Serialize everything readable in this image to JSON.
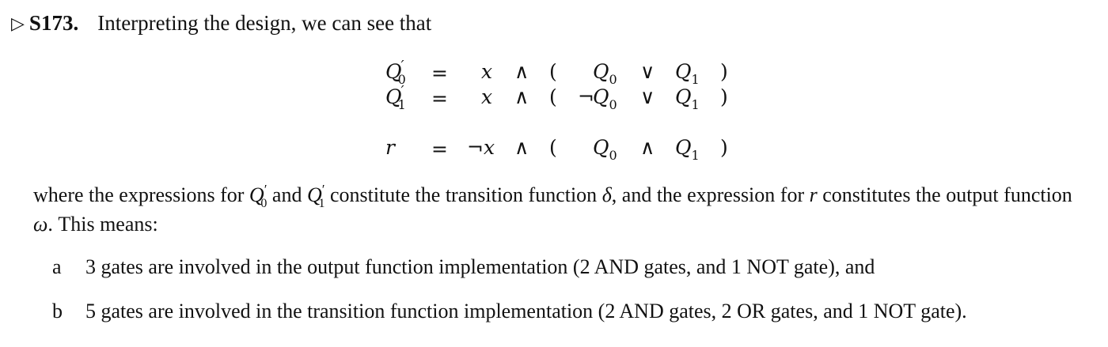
{
  "heading": {
    "marker": "▷",
    "number": "S173.",
    "text": "Interpreting the design, we can see that"
  },
  "equations": [
    {
      "lhs_base": "Q",
      "lhs_prime": "′",
      "lhs_sub": "0",
      "eq": "=",
      "x": "x",
      "op1": "∧",
      "open": "(",
      "neg": "",
      "a_base": "Q",
      "a_sub": "0",
      "op2": "∨",
      "b_base": "Q",
      "b_sub": "1",
      "close": ")"
    },
    {
      "lhs_base": "Q",
      "lhs_prime": "′",
      "lhs_sub": "1",
      "eq": "=",
      "x": "x",
      "op1": "∧",
      "open": "(",
      "neg": "¬",
      "a_base": "Q",
      "a_sub": "0",
      "op2": "∨",
      "b_base": "Q",
      "b_sub": "1",
      "close": ")"
    },
    {
      "lhs_base": "r",
      "lhs_prime": "",
      "lhs_sub": "",
      "eq": "=",
      "x": "¬x",
      "op1": "∧",
      "open": "(",
      "neg": "",
      "a_base": "Q",
      "a_sub": "0",
      "op2": "∧",
      "b_base": "Q",
      "b_sub": "1",
      "close": ")"
    }
  ],
  "paragraph": {
    "p1": "where the expressions for",
    "q0": "Q",
    "q0_prime": "′",
    "q0_sub": "0",
    "p2": "and",
    "q1": "Q",
    "q1_prime": "′",
    "q1_sub": "1",
    "p3": "constitute the transition function",
    "delta": "δ",
    "p4": ", and the expression for",
    "r": "r",
    "p5": "constitutes the output function",
    "omega": "ω",
    "p6": ". This means:"
  },
  "items": [
    {
      "marker": "a",
      "text": "3 gates are involved in the output function implementation (2 AND gates, and 1 NOT gate), and"
    },
    {
      "marker": "b",
      "text": "5 gates are involved in the transition function implementation (2 AND gates, 2 OR gates, and 1 NOT gate)."
    }
  ]
}
